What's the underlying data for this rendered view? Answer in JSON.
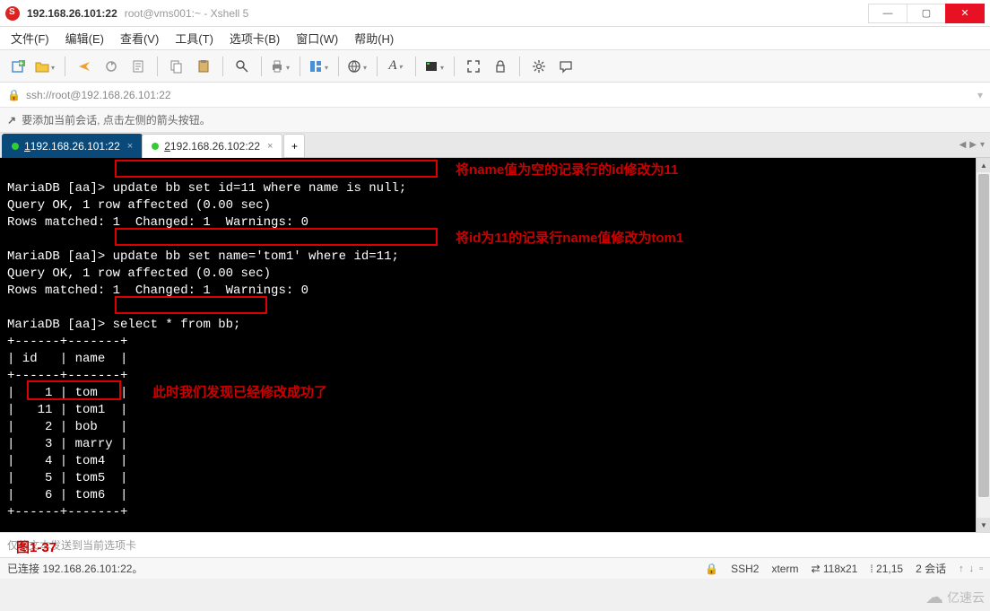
{
  "window": {
    "title_host": "192.168.26.101:22",
    "title_sub": "root@vms001:~ - Xshell 5",
    "min": "—",
    "max": "▢",
    "close": "✕"
  },
  "menu": {
    "file": "文件(F)",
    "edit": "编辑(E)",
    "view": "查看(V)",
    "tools": "工具(T)",
    "tab": "选项卡(B)",
    "window": "窗口(W)",
    "help": "帮助(H)"
  },
  "address": {
    "url": "ssh://root@192.168.26.101:22"
  },
  "hint": {
    "text": "要添加当前会话, 点击左侧的箭头按钮。"
  },
  "tabs": {
    "t1_num": "1",
    "t1_label": " 192.168.26.101:22",
    "t2_num": "2",
    "t2_label": " 192.168.26.102:22",
    "add": "+",
    "nav_left": "◀",
    "nav_right": "▶",
    "nav_menu": "▾"
  },
  "terminal": {
    "line1_prompt": "MariaDB [aa]> ",
    "line1_cmd": "update bb set id=11 where name is null;",
    "line2": "Query OK, 1 row affected (0.00 sec)",
    "line3": "Rows matched: 1  Changed: 1  Warnings: 0",
    "blank1": "",
    "line4_prompt": "MariaDB [aa]> ",
    "line4_cmd": "update bb set name='tom1' where id=11;",
    "line5": "Query OK, 1 row affected (0.00 sec)",
    "line6": "Rows matched: 1  Changed: 1  Warnings: 0",
    "blank2": "",
    "line7_prompt": "MariaDB [aa]> ",
    "line7_cmd": "select * from bb;",
    "sep1": "+------+-------+",
    "hdr": "| id   | name  |",
    "sep2": "+------+-------+",
    "row1": "|    1 | tom   |",
    "row2": "|   11 | tom1  |",
    "row3": "|    2 | bob   |",
    "row4": "|    3 | marry |",
    "row5": "|    4 | tom4  |",
    "row6": "|    5 | tom5  |",
    "row7": "|    6 | tom6  |",
    "sep3": "+------+-------+"
  },
  "annotations": {
    "a1": "将name值为空的记录行的id修改为11",
    "a2": "将id为11的记录行name值修改为tom1",
    "a3": "此时我们发现已经修改成功了",
    "fig": "图1-37"
  },
  "composer": {
    "placeholder": "仅将文本发送到当前选项卡"
  },
  "status": {
    "connected": "已连接 192.168.26.101:22。",
    "ssh": "SSH2",
    "term": "xterm",
    "size": "118x21",
    "pos": "21,15",
    "sessions": "2 会话",
    "size_icon": "⇄",
    "pos_icon": "⁞",
    "up": "↑",
    "down": "↓"
  },
  "watermark": {
    "brand": "亿速云"
  }
}
